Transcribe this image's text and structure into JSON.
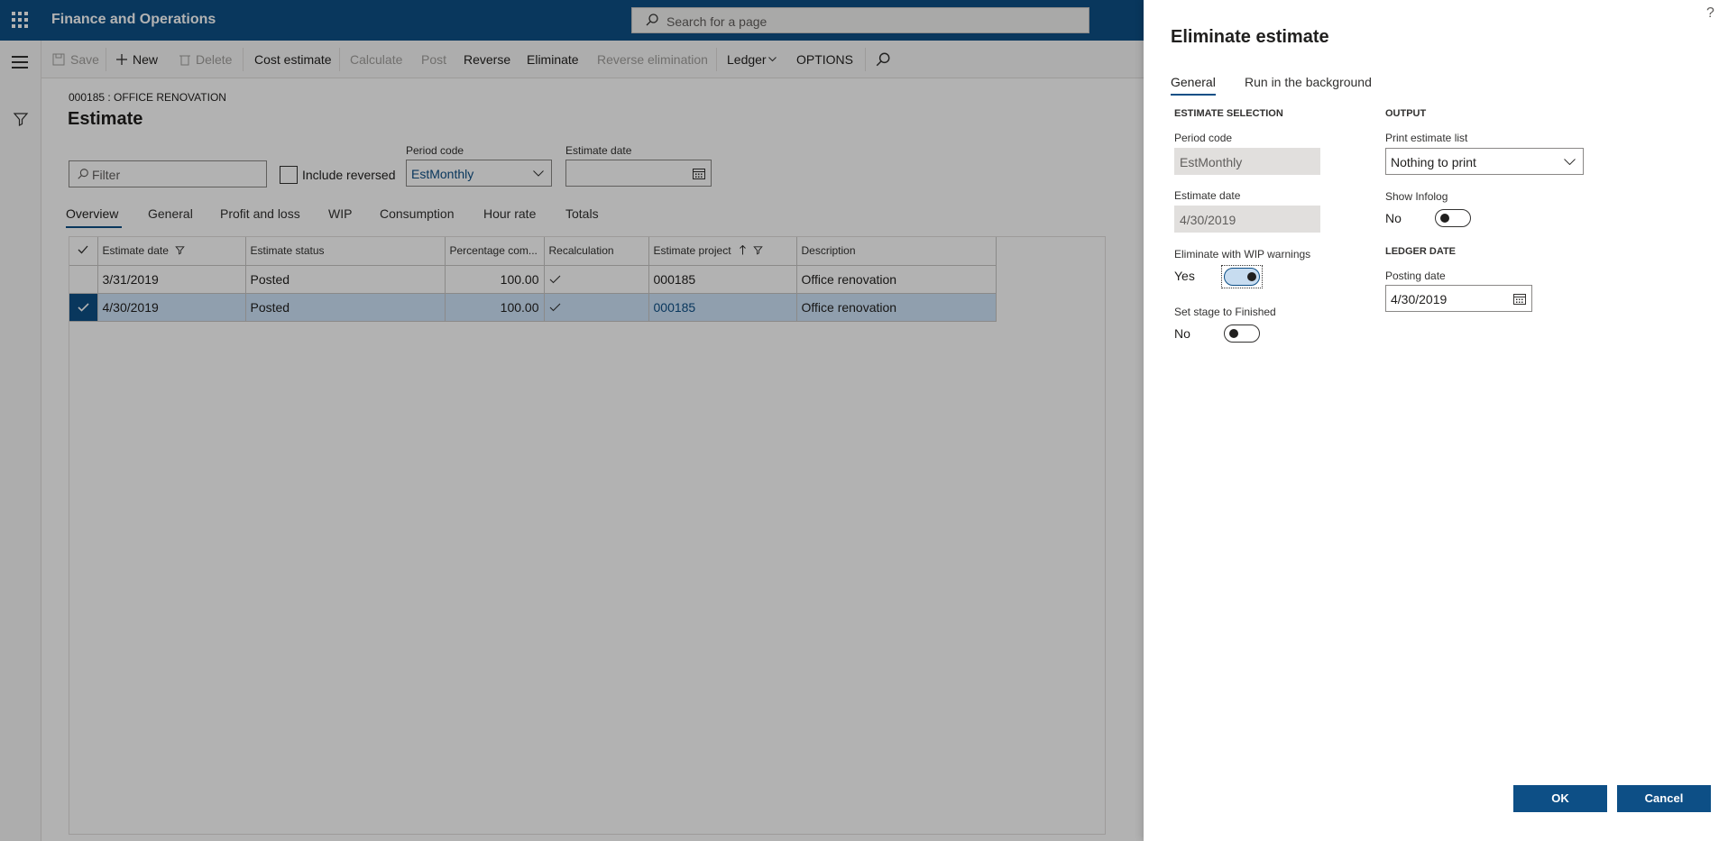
{
  "topbar": {
    "app_title": "Finance and Operations",
    "search_placeholder": "Search for a page"
  },
  "actions": {
    "save": "Save",
    "new": "New",
    "delete": "Delete",
    "cost_estimate": "Cost estimate",
    "calculate": "Calculate",
    "post": "Post",
    "reverse": "Reverse",
    "eliminate": "Eliminate",
    "reverse_elimination": "Reverse elimination",
    "ledger": "Ledger",
    "options": "OPTIONS"
  },
  "page": {
    "breadcrumb": "000185 : OFFICE RENOVATION",
    "title": "Estimate",
    "filter_placeholder": "Filter",
    "include_reversed": "Include reversed",
    "period_code_label": "Period code",
    "period_code_value": "EstMonthly",
    "estimate_date_label": "Estimate date"
  },
  "tabs": [
    "Overview",
    "General",
    "Profit and loss",
    "WIP",
    "Consumption",
    "Hour rate",
    "Totals"
  ],
  "grid": {
    "columns": [
      "Estimate date",
      "Estimate status",
      "Percentage com...",
      "Recalculation",
      "Estimate project",
      "Description"
    ],
    "rows": [
      {
        "date": "3/31/2019",
        "status": "Posted",
        "pct": "100.00",
        "project": "000185",
        "desc": "Office renovation"
      },
      {
        "date": "4/30/2019",
        "status": "Posted",
        "pct": "100.00",
        "project": "000185",
        "desc": "Office renovation"
      }
    ]
  },
  "dialog": {
    "title": "Eliminate estimate",
    "help": "?",
    "tab_general": "General",
    "tab_background": "Run in the background",
    "sec_estimate_selection": "ESTIMATE SELECTION",
    "period_code_label": "Period code",
    "period_code_value": "EstMonthly",
    "estimate_date_label": "Estimate date",
    "estimate_date_value": "4/30/2019",
    "wip_warnings_label": "Eliminate with WIP warnings",
    "wip_warnings_value": "Yes",
    "stage_finished_label": "Set stage to Finished",
    "stage_finished_value": "No",
    "sec_output": "OUTPUT",
    "print_list_label": "Print estimate list",
    "print_list_value": "Nothing to print",
    "show_infolog_label": "Show Infolog",
    "show_infolog_value": "No",
    "sec_ledger_date": "LEDGER DATE",
    "posting_date_label": "Posting date",
    "posting_date_value": "4/30/2019",
    "ok": "OK",
    "cancel": "Cancel"
  }
}
